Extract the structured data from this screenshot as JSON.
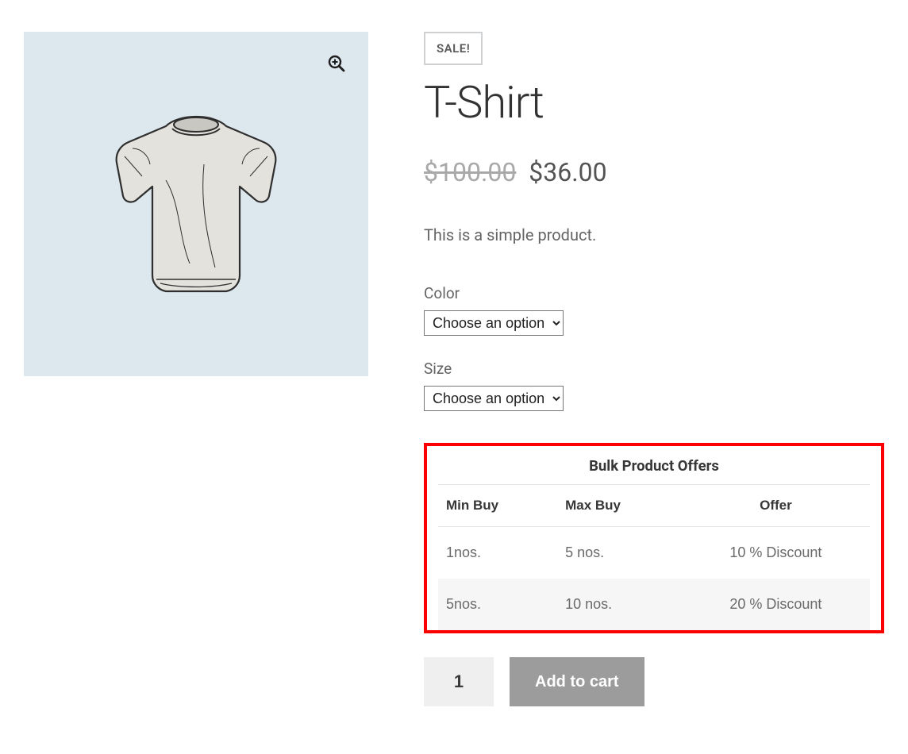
{
  "sale_badge": "SALE!",
  "product_title": "T-Shirt",
  "currency": "$",
  "old_price": "100.00",
  "sale_price": "36.00",
  "description": "This is a simple product.",
  "variations": {
    "color": {
      "label": "Color",
      "placeholder": "Choose an option"
    },
    "size": {
      "label": "Size",
      "placeholder": "Choose an option"
    }
  },
  "offers": {
    "heading": "Bulk Product Offers",
    "columns": {
      "min": "Min Buy",
      "max": "Max Buy",
      "offer": "Offer"
    },
    "rows": [
      {
        "min": "1nos.",
        "max": "5 nos.",
        "offer": "10 % Discount"
      },
      {
        "min": "5nos.",
        "max": "10 nos.",
        "offer": "20 % Discount"
      }
    ]
  },
  "quantity": "1",
  "add_to_cart": "Add to cart"
}
